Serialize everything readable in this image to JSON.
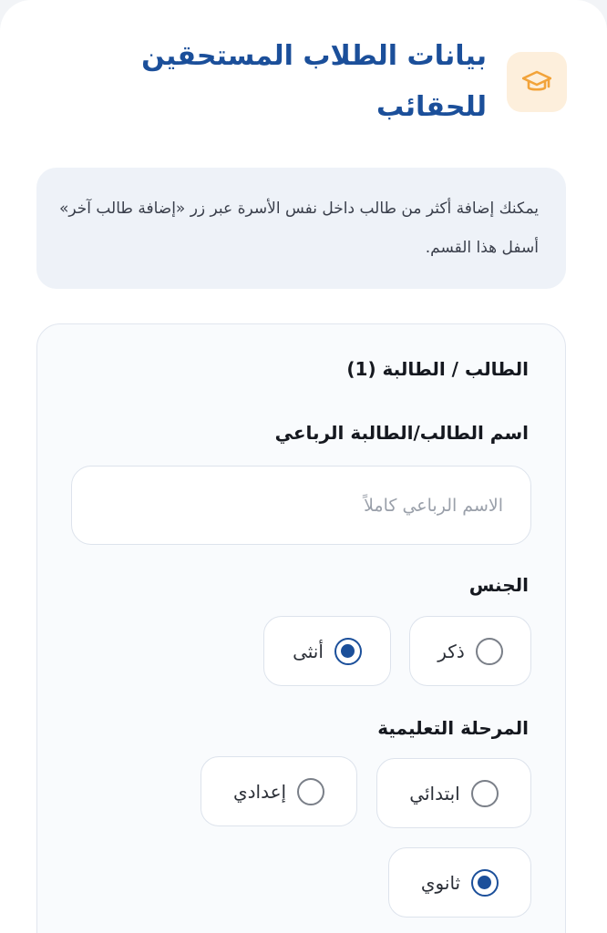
{
  "header": {
    "title": "بيانات الطلاب المستحقين للحقائب",
    "icon": "graduation-cap-icon",
    "icon_color": "#f2a33a",
    "title_color": "#1b4f9a"
  },
  "info": {
    "text": "يمكنك إضافة أكثر من طالب داخل نفس الأسرة عبر زر «إضافة طالب آخر» أسفل هذا القسم."
  },
  "student": {
    "title": "الطالب / الطالبة (1)",
    "name_field": {
      "label": "اسم الطالب/الطالبة الرباعي",
      "value": "",
      "placeholder": "الاسم الرباعي كاملاً"
    },
    "gender": {
      "label": "الجنس",
      "options": [
        {
          "label": "ذكر",
          "selected": false
        },
        {
          "label": "أنثى",
          "selected": true
        }
      ]
    },
    "stage": {
      "label": "المرحلة التعليمية",
      "options": [
        {
          "label": "ابتدائي",
          "selected": false
        },
        {
          "label": "إعدادي",
          "selected": false
        },
        {
          "label": "ثانوي",
          "selected": true
        }
      ]
    }
  },
  "accent_color": "#1b4f9a"
}
